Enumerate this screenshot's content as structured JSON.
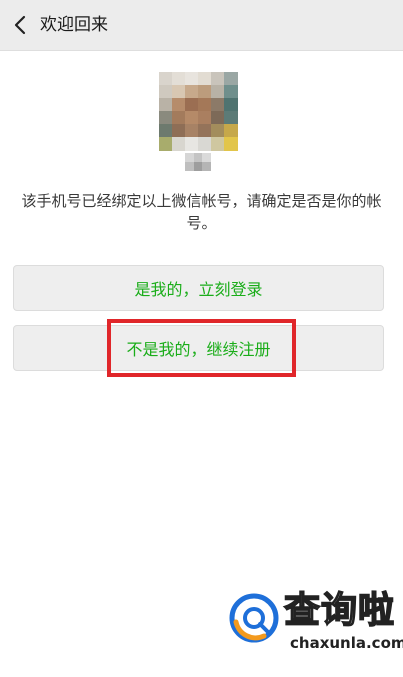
{
  "header": {
    "title": "欢迎回来",
    "back_icon": "chevron-left-icon"
  },
  "account": {
    "avatar": "pixelated-avatar",
    "nickname": "pixelated-nickname"
  },
  "notice_text": "该手机号已经绑定以上微信帐号，请确定是否是你的帐号。",
  "buttons": {
    "login": "是我的，立刻登录",
    "register": "不是我的，继续注册"
  },
  "watermark": {
    "title": "查询啦",
    "url": "chaxunla.com"
  },
  "colors": {
    "accent_green": "#1aad19",
    "highlight_red": "#e0262a",
    "header_bg": "#ececec",
    "button_bg": "#eeeeee"
  }
}
